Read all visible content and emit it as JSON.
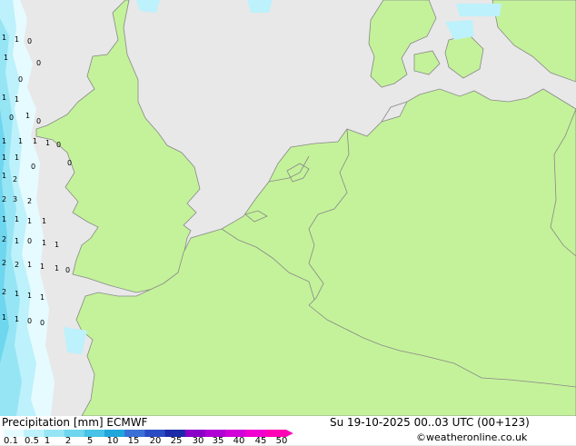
{
  "map": {
    "land_color": "#c4f29a",
    "sea_color": "#e8e8e8",
    "border_color": "#888888",
    "values": [
      "1",
      "1",
      "0",
      "0",
      "1",
      "0",
      "1",
      "1",
      "1",
      "0",
      "0",
      "1",
      "1",
      "1",
      "1",
      "0",
      "0",
      "1",
      "1",
      "0",
      "1",
      "2",
      "2",
      "3",
      "2",
      "1",
      "1",
      "1",
      "1",
      "2",
      "1",
      "0",
      "1",
      "1",
      "2",
      "2",
      "1",
      "1",
      "1",
      "0",
      "2",
      "1",
      "1",
      "1",
      "1",
      "1",
      "0",
      "0"
    ]
  },
  "footer": {
    "title": "Precipitation [mm] ECMWF",
    "datetime": "Su 19-10-2025 00..03 UTC (00+123)",
    "credit": "©weatheronline.co.uk",
    "legend": {
      "labels": [
        "0.1",
        "0.5",
        "1",
        "2",
        "5",
        "10",
        "15",
        "20",
        "25",
        "30",
        "35",
        "40",
        "45",
        "50"
      ],
      "colors": [
        "#e6fbff",
        "#bdf1fb",
        "#96e5f5",
        "#6ed6ee",
        "#46c3e6",
        "#1fa7dc",
        "#3a6fd8",
        "#2b4bc4",
        "#1c2aa8",
        "#8a00c8",
        "#b000d4",
        "#d200d8",
        "#f000d0",
        "#ff00b4"
      ]
    }
  }
}
